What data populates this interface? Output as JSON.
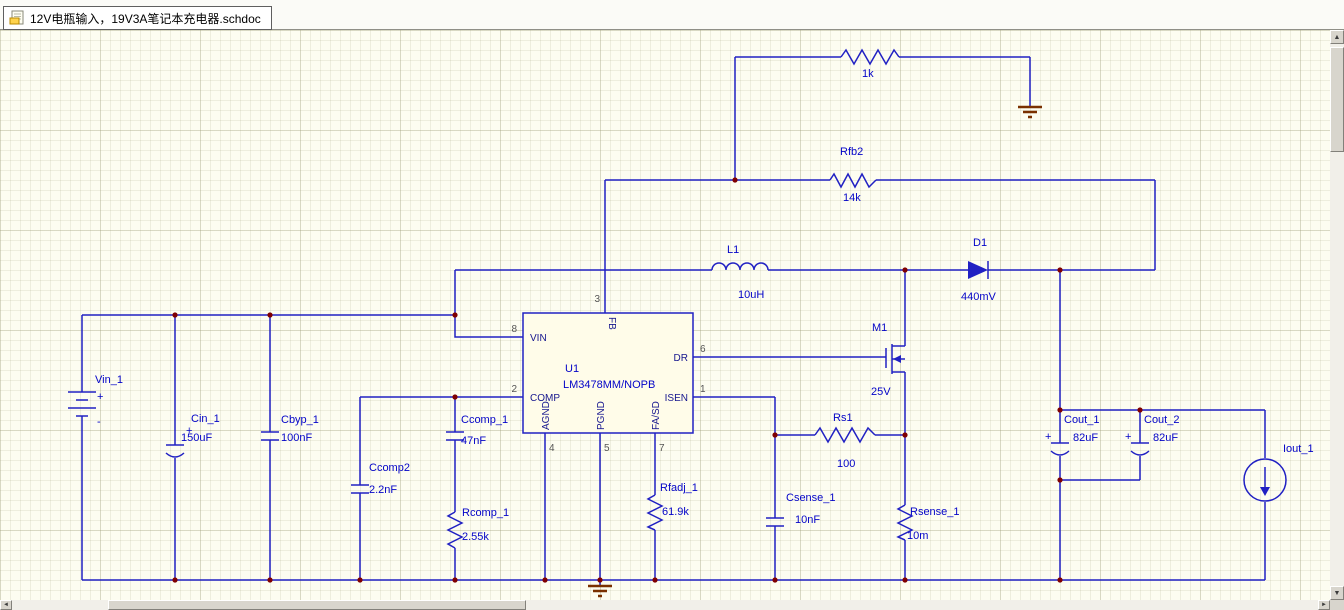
{
  "window": {
    "tab_label": "12V电瓶输入，19V3A笔记本充电器.schdoc"
  },
  "colors": {
    "wire": "#2121c3",
    "text": "#0404c8",
    "pin_text": "#16168e",
    "pin_number": "#555555",
    "junction": "#800000",
    "ground": "#7a3000",
    "canvas": "#fdfdf1"
  },
  "components": {
    "rfb1": {
      "value": "1k"
    },
    "rfb2": {
      "designator": "Rfb2",
      "value": "14k"
    },
    "l1": {
      "designator": "L1",
      "value": "10uH"
    },
    "d1": {
      "designator": "D1",
      "value": "440mV"
    },
    "m1": {
      "designator": "M1",
      "value": "25V"
    },
    "vin1": {
      "designator": "Vin_1",
      "plus": "+",
      "minus": "-"
    },
    "cin1": {
      "designator": "Cin_1",
      "value": "150uF",
      "plus": "+"
    },
    "cbyp1": {
      "designator": "Cbyp_1",
      "value": "100nF"
    },
    "ccomp2": {
      "designator": "Ccomp2",
      "value": "2.2nF"
    },
    "ccomp1": {
      "designator": "Ccomp_1",
      "value": "47nF"
    },
    "rcomp1": {
      "designator": "Rcomp_1",
      "value": "2.55k"
    },
    "rfadj1": {
      "designator": "Rfadj_1",
      "value": "61.9k"
    },
    "csense1": {
      "designator": "Csense_1",
      "value": "10nF"
    },
    "rs1": {
      "designator": "Rs1",
      "value": "100"
    },
    "rsense1": {
      "designator": "Rsense_1",
      "value": "10m"
    },
    "cout1": {
      "designator": "Cout_1",
      "value": "82uF",
      "plus": "+"
    },
    "cout2": {
      "designator": "Cout_2",
      "value": "82uF",
      "plus": "+"
    },
    "iout1": {
      "designator": "Iout_1"
    },
    "u1": {
      "designator": "U1",
      "comment": "LM3478MM/NOPB",
      "pins": {
        "vin": {
          "num": "8",
          "name": "VIN"
        },
        "comp": {
          "num": "2",
          "name": "COMP"
        },
        "fb": {
          "num": "3",
          "name": "FB"
        },
        "dr": {
          "num": "6",
          "name": "DR"
        },
        "isen": {
          "num": "1",
          "name": "ISEN"
        },
        "agnd": {
          "num": "4",
          "name": "AGND"
        },
        "pgnd": {
          "num": "5",
          "name": "PGND"
        },
        "fasd": {
          "num": "7",
          "name": "FA/SD"
        }
      }
    }
  }
}
